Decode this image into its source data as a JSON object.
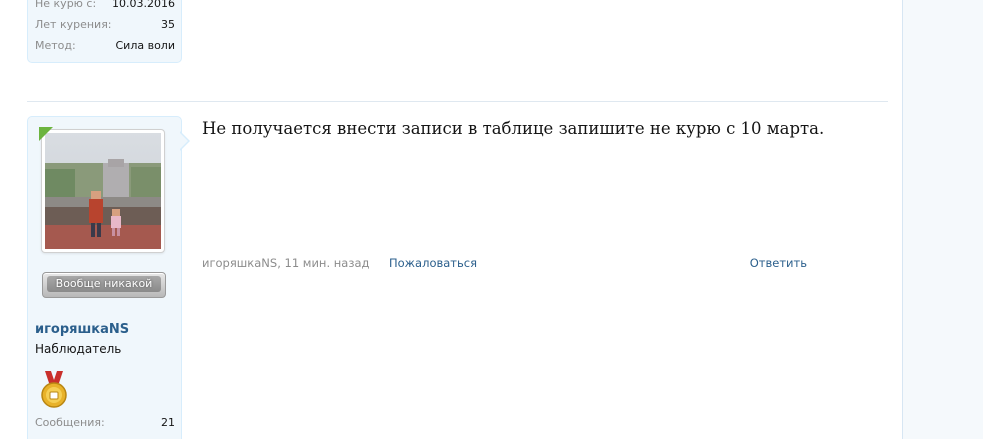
{
  "previous_post": {
    "rows": [
      {
        "label": "Не курю с:",
        "value": "10.03.2016"
      },
      {
        "label": "Лет курения:",
        "value": "35"
      },
      {
        "label": "Метод:",
        "value": "Сила воли"
      }
    ]
  },
  "post": {
    "user": {
      "username": "игоряшкаNS",
      "title": "Наблюдатель",
      "rank_badge": "Вообще никакой",
      "stats": [
        {
          "label": "Сообщения:",
          "value": "21"
        }
      ]
    },
    "message": "Не получается внести записи в таблице запишите не курю с 10 марта.",
    "meta": "игоряшкаNS, 11 мин. назад",
    "report_label": "Пожаловаться",
    "reply_label": "Ответить"
  },
  "colors": {
    "link": "#2b5f8c",
    "user_block_bg": "#f0f7fc",
    "user_block_border": "#d7edfc",
    "muted_text": "#8c8c8c",
    "corner_ribbon": "#6cb43f"
  },
  "icons": {
    "medal": "gold-medal-icon"
  }
}
